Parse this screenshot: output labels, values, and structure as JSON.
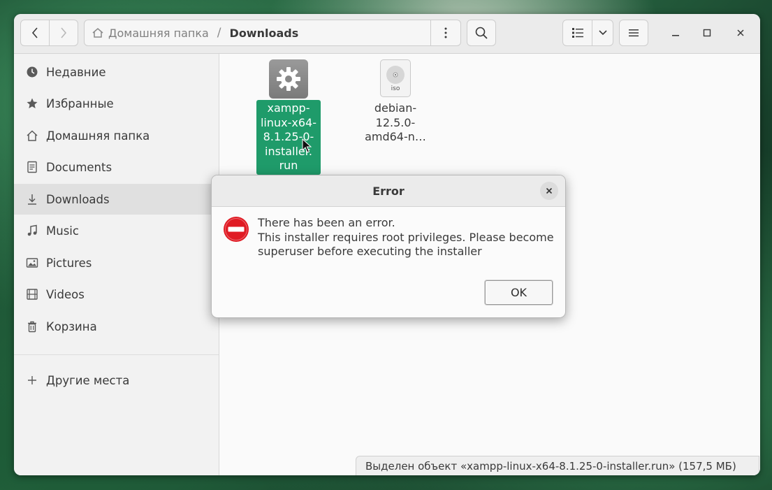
{
  "header": {
    "path_home_label": "Домашняя папка",
    "path_separator": "/",
    "path_current": "Downloads"
  },
  "sidebar": {
    "items": [
      {
        "label": "Недавние",
        "icon": "clock-icon"
      },
      {
        "label": "Избранные",
        "icon": "star-icon"
      },
      {
        "label": "Домашняя папка",
        "icon": "home-icon"
      },
      {
        "label": "Documents",
        "icon": "document-icon"
      },
      {
        "label": "Downloads",
        "icon": "download-icon",
        "active": true
      },
      {
        "label": "Music",
        "icon": "music-note-icon"
      },
      {
        "label": "Pictures",
        "icon": "picture-icon"
      },
      {
        "label": "Videos",
        "icon": "film-icon"
      },
      {
        "label": "Корзина",
        "icon": "trash-icon"
      }
    ],
    "other_places": {
      "label": "Другие места",
      "icon": "plus-icon"
    }
  },
  "files": [
    {
      "lines": [
        "xampp-",
        "linux-x64-",
        "8.1.25-0-",
        "installer.",
        "run"
      ],
      "icon": "gear-icon",
      "selected": true
    },
    {
      "lines": [
        "debian-",
        "12.5.0-",
        "amd64-n…"
      ],
      "icon": "disc-iso-icon",
      "badge": "iso",
      "selected": false
    }
  ],
  "status": {
    "text": "Выделен объект «xampp-linux-x64-8.1.25-0-installer.run»  (157,5 МБ)"
  },
  "dialog": {
    "title": "Error",
    "message_lines": [
      "There has been an error.",
      "This installer requires root privileges. Please become",
      "superuser before executing the installer"
    ],
    "ok_label": "OK"
  },
  "colors": {
    "selection": "#1f9b6a",
    "error_icon": "#e01b24",
    "headerbar": "#ebebeb",
    "sidebar_bg": "#f2f2f2"
  }
}
